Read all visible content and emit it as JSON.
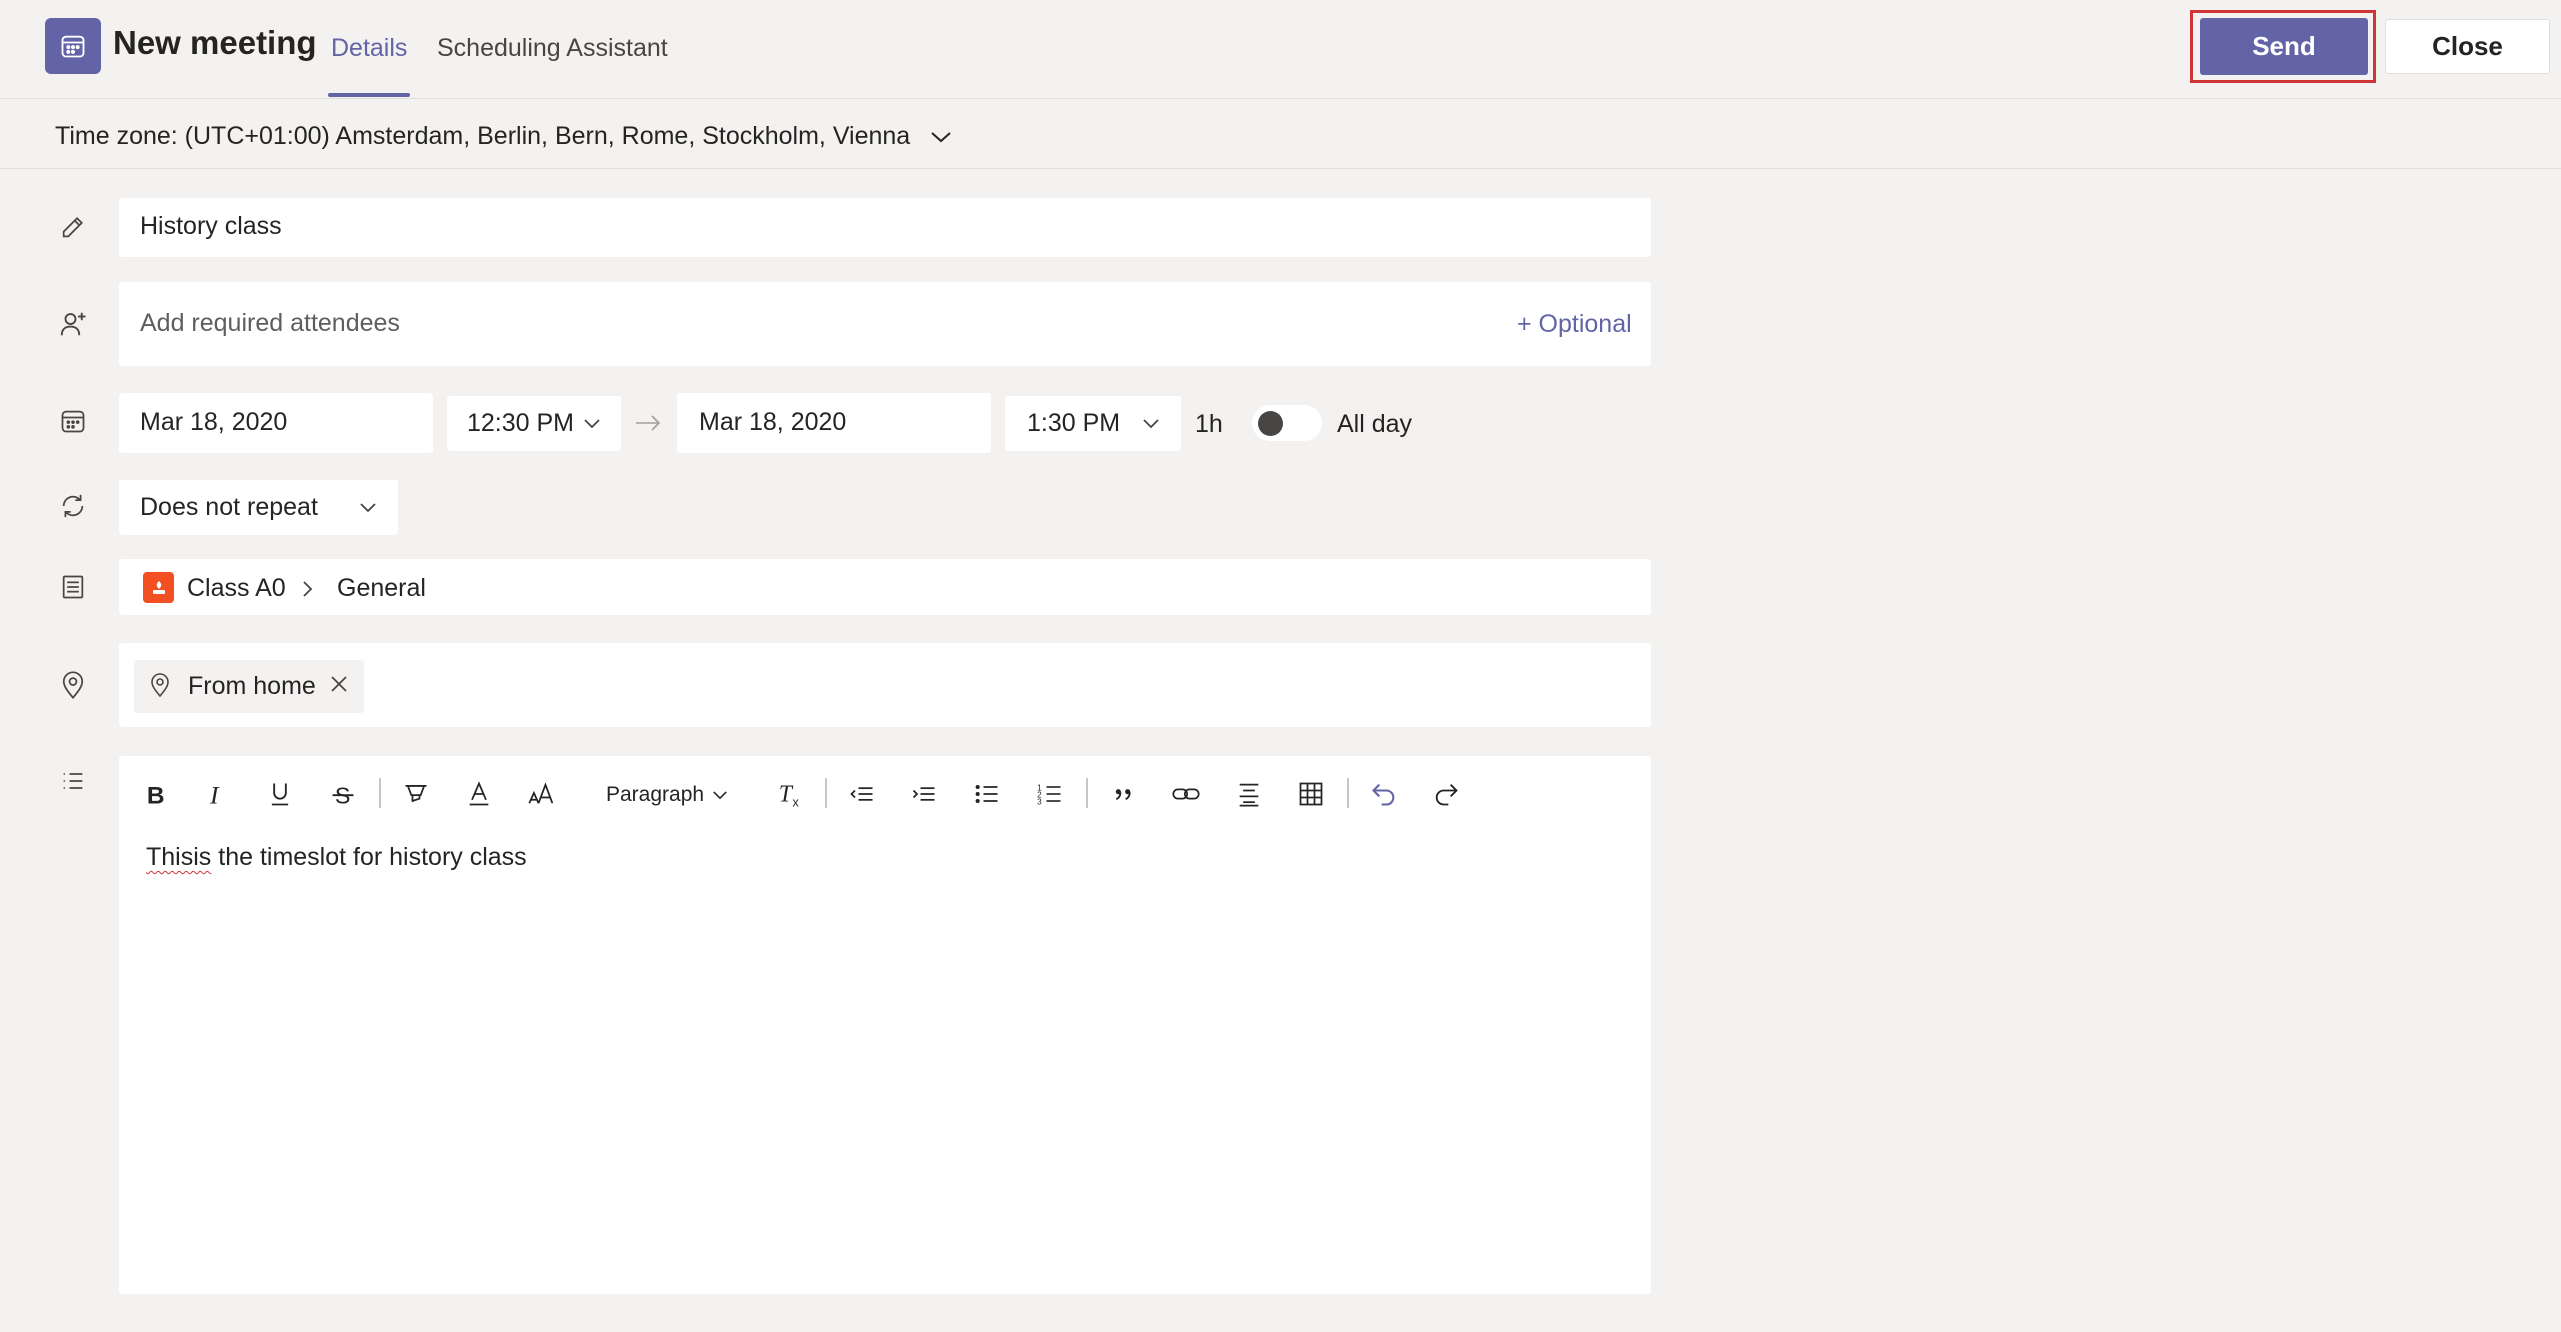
{
  "header": {
    "title": "New meeting",
    "tabs": [
      {
        "label": "Details",
        "active": true
      },
      {
        "label": "Scheduling Assistant",
        "active": false
      }
    ],
    "send_label": "Send",
    "close_label": "Close"
  },
  "timezone": {
    "label": "Time zone: (UTC+01:00) Amsterdam, Berlin, Bern, Rome, Stockholm, Vienna"
  },
  "form": {
    "title_value": "History class",
    "attendees_placeholder": "Add required attendees",
    "optional_label": "+ Optional",
    "start_date": "Mar 18, 2020",
    "start_time": "12:30 PM",
    "end_date": "Mar 18, 2020",
    "end_time": "1:30 PM",
    "duration": "1h",
    "all_day_label": "All day",
    "all_day_on": false,
    "repeat": "Does not repeat",
    "channel_team": "Class A0",
    "channel_name": "General",
    "location": "From home"
  },
  "editor": {
    "paragraph_label": "Paragraph",
    "body_misspelled": "Thisis",
    "body_rest": " the timeslot for history class",
    "toolbar": [
      "bold-icon",
      "italic-icon",
      "underline-icon",
      "strikethrough-icon",
      "highlight-icon",
      "font-color-icon",
      "font-size-icon",
      "paragraph-style",
      "clear-formatting-icon",
      "decrease-indent-icon",
      "increase-indent-icon",
      "bulleted-list-icon",
      "numbered-list-icon",
      "quote-icon",
      "link-icon",
      "align-icon",
      "table-icon",
      "undo-icon",
      "redo-icon"
    ]
  },
  "colors": {
    "accent": "#6264a7",
    "background": "#f3f2f1",
    "highlight_outline": "#d13438",
    "channel_icon": "#f25022"
  }
}
